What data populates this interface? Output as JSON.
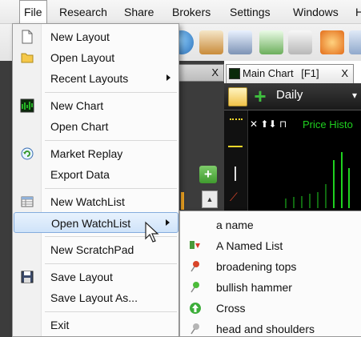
{
  "menubar": {
    "items": [
      {
        "label": "File"
      },
      {
        "label": "Research"
      },
      {
        "label": "Share"
      },
      {
        "label": "Brokers"
      },
      {
        "label": "Settings"
      },
      {
        "label": "Windows"
      },
      {
        "label": "H"
      }
    ]
  },
  "file_menu": {
    "items": [
      {
        "label": "New Layout",
        "icon": "new-document-icon"
      },
      {
        "label": "Open Layout",
        "icon": "folder-icon"
      },
      {
        "label": "Recent Layouts",
        "icon": "",
        "submenu": true
      },
      {
        "label": "New Chart",
        "icon": "chart-icon"
      },
      {
        "label": "Open Chart",
        "icon": ""
      },
      {
        "label": "Market Replay",
        "icon": "replay-icon"
      },
      {
        "label": "Export Data",
        "icon": ""
      },
      {
        "label": "New WatchList",
        "icon": "list-grid-icon"
      },
      {
        "label": "Open WatchList",
        "icon": "",
        "submenu": true,
        "highlighted": true
      },
      {
        "label": "New ScratchPad",
        "icon": ""
      },
      {
        "label": "Save Layout",
        "icon": "save-icon"
      },
      {
        "label": "Save Layout As...",
        "icon": ""
      },
      {
        "label": "Exit",
        "icon": ""
      }
    ]
  },
  "watchlist_submenu": {
    "items": [
      {
        "label": "a name",
        "icon": ""
      },
      {
        "label": "A Named List",
        "icon": "down-arrow-icon"
      },
      {
        "label": "broadening tops",
        "icon": "red-pin-icon"
      },
      {
        "label": "bullish hammer",
        "icon": "green-pin-icon"
      },
      {
        "label": "Cross",
        "icon": "green-up-circle-icon"
      },
      {
        "label": "head and shoulders",
        "icon": "grey-pin-icon"
      }
    ]
  },
  "chart_window": {
    "tab_label": "Main Chart",
    "tab_shortcut": "[F1]",
    "tab_close": "X",
    "period": "Daily",
    "indicator_label": "Price Histo"
  },
  "left_panel": {
    "close_label": "X"
  }
}
